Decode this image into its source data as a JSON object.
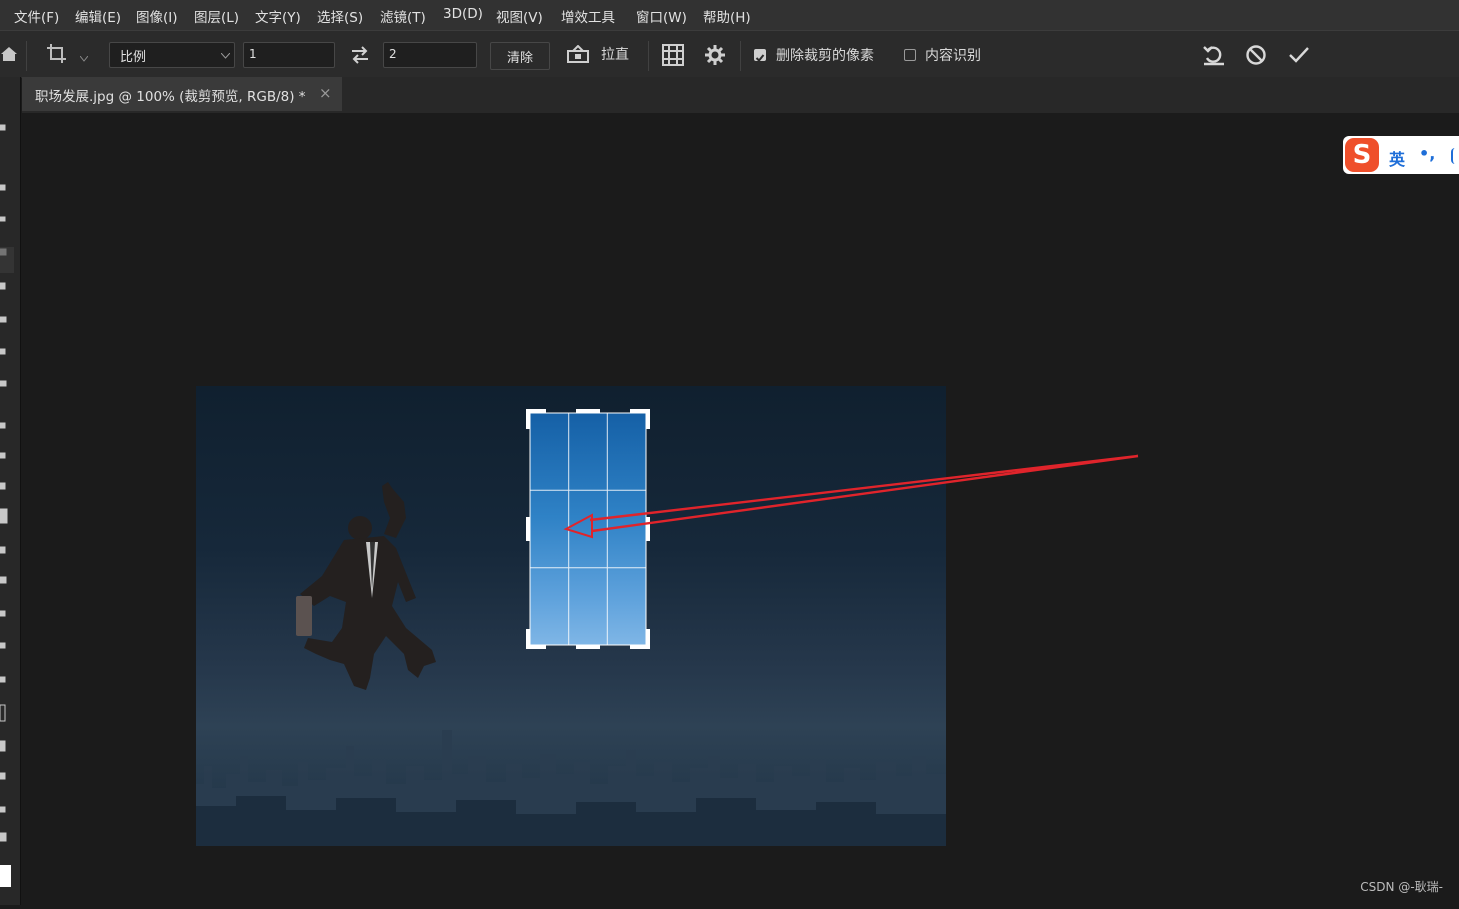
{
  "menu": [
    "文件(F)",
    "编辑(E)",
    "图像(I)",
    "图层(L)",
    "文字(Y)",
    "选择(S)",
    "滤镜(T)",
    "3D(D)",
    "视图(V)",
    "增效工具",
    "窗口(W)",
    "帮助(H)"
  ],
  "options": {
    "ratio_mode": "比例",
    "ratio_w": "1",
    "ratio_h": "2",
    "clear_label": "清除",
    "straighten_label": "拉直",
    "delete_pixels_label": "删除裁剪的像素",
    "delete_pixels_checked": true,
    "content_aware_label": "内容识别",
    "content_aware_checked": false
  },
  "document": {
    "tab_title": "职场发展.jpg @ 100% (裁剪预览, RGB/8) *",
    "close_glyph": "×"
  },
  "ime": {
    "logo": "S",
    "mode": "英",
    "punct": "•,"
  },
  "watermark": "CSDN @-耿瑞-",
  "colors": {
    "accent_arrow": "#e0242b",
    "crop_fill_top": "#1560a6",
    "crop_fill_bottom": "#7fb6e6",
    "menubar": "#323232"
  }
}
